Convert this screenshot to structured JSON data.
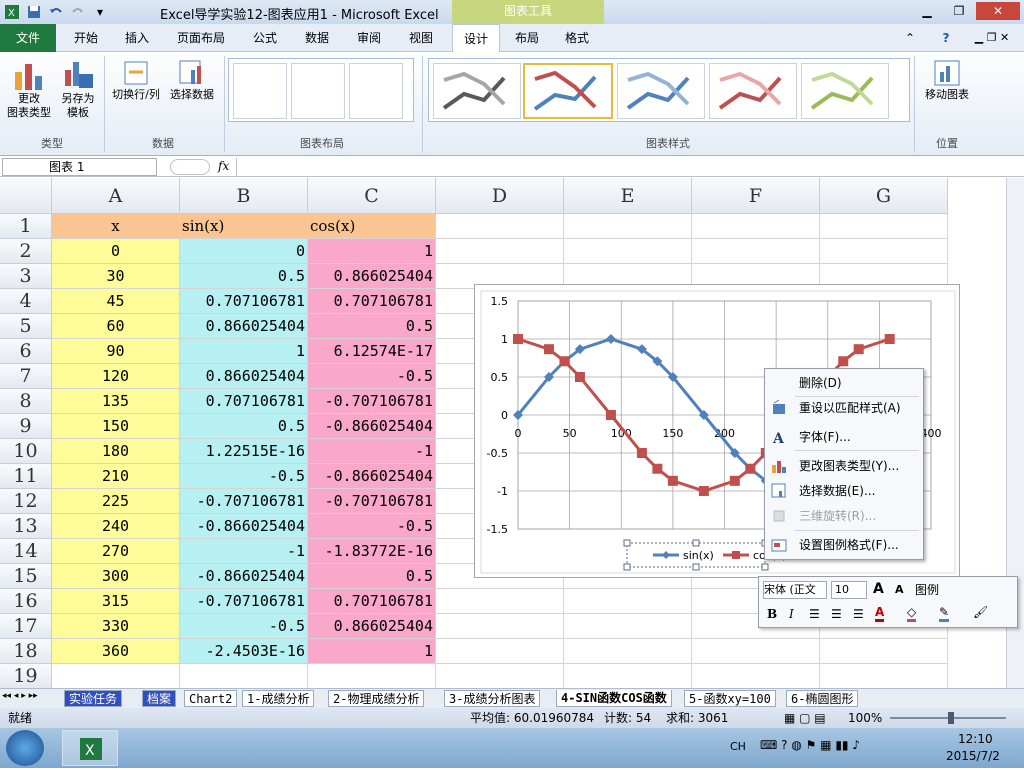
{
  "titlebar": {
    "title": "Excel导学实验12-图表应用1  -  Microsoft Excel",
    "context_tools": "图表工具"
  },
  "tabs": {
    "file": "文件",
    "home": "开始",
    "insert": "插入",
    "layout_page": "页面布局",
    "formulas": "公式",
    "data": "数据",
    "review": "审阅",
    "view": "视图",
    "design": "设计",
    "chart_layout": "布局",
    "format": "格式"
  },
  "ribbon": {
    "change_type": "更改\n图表类型",
    "save_template": "另存为\n模板",
    "group_type": "类型",
    "switch_rowcol": "切换行/列",
    "select_data": "选择数据",
    "group_data": "数据",
    "group_layouts": "图表布局",
    "group_styles": "图表样式",
    "move_chart": "移动图表",
    "group_location": "位置"
  },
  "formula_bar": {
    "name_box": "图表 1",
    "fx": "fx",
    "value": ""
  },
  "columns": [
    "A",
    "B",
    "C",
    "D",
    "E",
    "F",
    "G"
  ],
  "rows": [
    "1",
    "2",
    "3",
    "4",
    "5",
    "6",
    "7",
    "8",
    "9",
    "10",
    "11",
    "12",
    "13",
    "14",
    "15",
    "16",
    "17",
    "18",
    "19"
  ],
  "table": {
    "headers": [
      "x",
      "sin(x)",
      "cos(x)"
    ],
    "rows": [
      [
        "0",
        "0",
        "1"
      ],
      [
        "30",
        "0.5",
        "0.866025404"
      ],
      [
        "45",
        "0.707106781",
        "0.707106781"
      ],
      [
        "60",
        "0.866025404",
        "0.5"
      ],
      [
        "90",
        "1",
        "6.12574E-17"
      ],
      [
        "120",
        "0.866025404",
        "-0.5"
      ],
      [
        "135",
        "0.707106781",
        "-0.707106781"
      ],
      [
        "150",
        "0.5",
        "-0.866025404"
      ],
      [
        "180",
        "1.22515E-16",
        "-1"
      ],
      [
        "210",
        "-0.5",
        "-0.866025404"
      ],
      [
        "225",
        "-0.707106781",
        "-0.707106781"
      ],
      [
        "240",
        "-0.866025404",
        "-0.5"
      ],
      [
        "270",
        "-1",
        "-1.83772E-16"
      ],
      [
        "300",
        "-0.866025404",
        "0.5"
      ],
      [
        "315",
        "-0.707106781",
        "0.707106781"
      ],
      [
        "330",
        "-0.5",
        "0.866025404"
      ],
      [
        "360",
        "-2.4503E-16",
        "1"
      ]
    ]
  },
  "chart_data": {
    "type": "line",
    "x": [
      0,
      30,
      45,
      60,
      90,
      120,
      135,
      150,
      180,
      210,
      225,
      240,
      270,
      300,
      315,
      330,
      360
    ],
    "series": [
      {
        "name": "sin(x)",
        "color": "#4f81bd",
        "values": [
          0,
          0.5,
          0.707106781,
          0.866025404,
          1,
          0.866025404,
          0.707106781,
          0.5,
          0,
          -0.5,
          -0.707106781,
          -0.866025404,
          -1,
          -0.866025404,
          -0.707106781,
          -0.5,
          0
        ]
      },
      {
        "name": "cos(x)",
        "color": "#c0504d",
        "values": [
          1,
          0.866025404,
          0.707106781,
          0.5,
          0,
          -0.5,
          -0.707106781,
          -0.866025404,
          -1,
          -0.866025404,
          -0.707106781,
          -0.5,
          0,
          0.5,
          0.707106781,
          0.866025404,
          1
        ]
      }
    ],
    "xlim": [
      0,
      400
    ],
    "xticks": [
      "0",
      "50",
      "100",
      "150",
      "200",
      "250",
      "300",
      "350",
      "400"
    ],
    "ylim": [
      -1.5,
      1.5
    ],
    "yticks": [
      "1.5",
      "1",
      "0.5",
      "0",
      "-0.5",
      "-1",
      "-1.5"
    ],
    "grid": true,
    "legend": "bottom"
  },
  "context_menu": {
    "items": [
      "删除(D)",
      "重设以匹配样式(A)",
      "字体(F)...",
      "更改图表类型(Y)...",
      "选择数据(E)...",
      "三维旋转(R)...",
      "设置图例格式(F)..."
    ]
  },
  "mini_toolbar": {
    "font": "宋体 (正文",
    "size": "10",
    "element": "图例",
    "grow": "A",
    "shrink": "A",
    "bold": "B",
    "italic": "I"
  },
  "sheet_tabs": [
    "实验任务",
    "档案",
    "Chart2",
    "1-成绩分析",
    "2-物理成绩分析",
    "3-成绩分析图表",
    "4-SIN函数COS函数",
    "5-函数xy=100",
    "6-椭圆图形"
  ],
  "status": {
    "ready": "就绪",
    "average": "平均值: 60.01960784",
    "count": "计数: 54",
    "sum": "求和: 3061",
    "zoom": "100%"
  },
  "taskbar": {
    "lang": "CH",
    "time": "12:10",
    "date": "2015/7/2"
  },
  "colors": {
    "header": "#fac592",
    "x_col": "#fdfc98",
    "sin_col": "#b7f0f3",
    "cos_col": "#f9a8c9",
    "excel_green": "#1f7a3f",
    "context_band": "#c8d67d"
  }
}
